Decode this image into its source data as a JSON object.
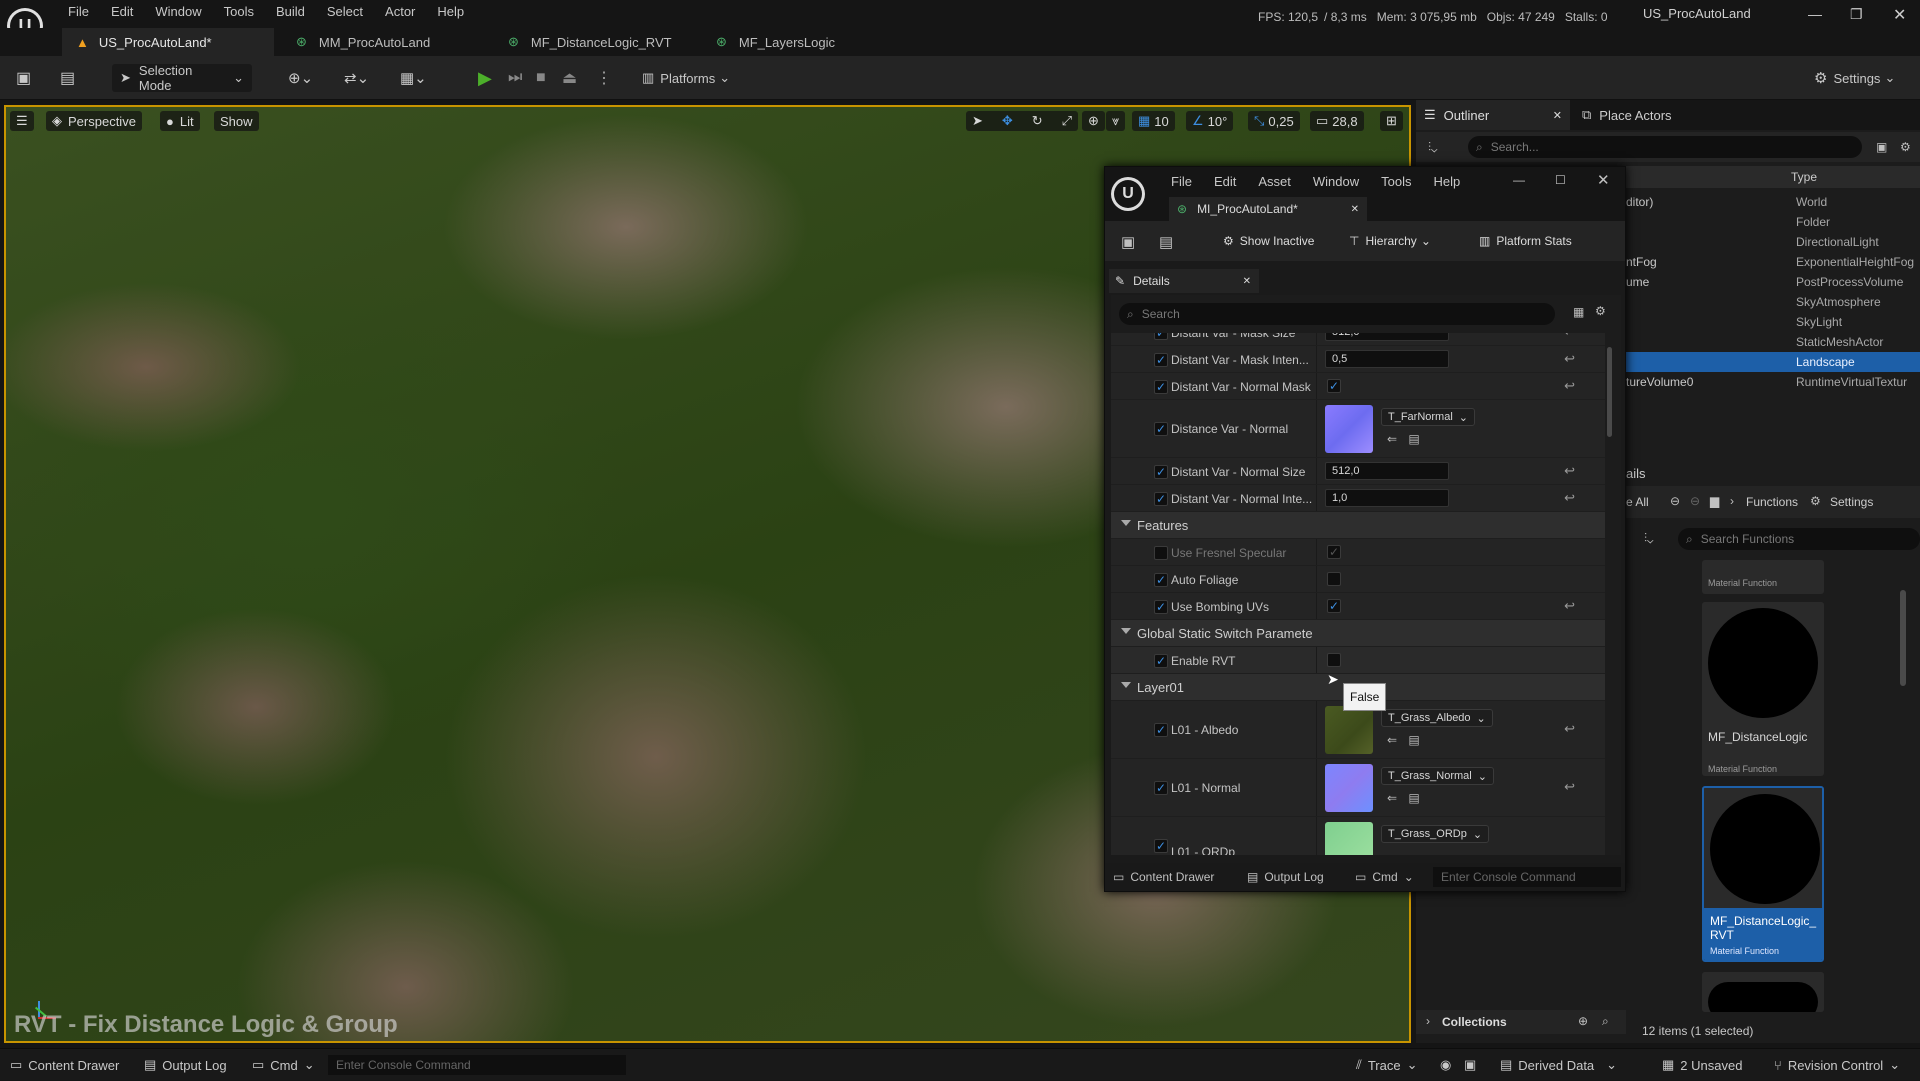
{
  "menu": [
    "File",
    "Edit",
    "Window",
    "Tools",
    "Build",
    "Select",
    "Actor",
    "Help"
  ],
  "stats": {
    "fps": "FPS: 120,5",
    "ms": "/ 8,3 ms",
    "mem": "Mem: 3 075,95 mb",
    "objs": "Objs: 47 249",
    "stalls": "Stalls: 0"
  },
  "project_name": "US_ProcAutoLand",
  "tabs": [
    {
      "label": "US_ProcAutoLand*",
      "active": true
    },
    {
      "label": "MM_ProcAutoLand",
      "active": false
    },
    {
      "label": "MF_DistanceLogic_RVT",
      "active": false
    },
    {
      "label": "MF_LayersLogic",
      "active": false
    }
  ],
  "toolbar": {
    "selection_mode": "Selection Mode",
    "platforms": "Platforms",
    "settings": "Settings"
  },
  "viewport": {
    "perspective": "Perspective",
    "lit": "Lit",
    "show": "Show",
    "grid_snap": "10",
    "angle_snap": "10°",
    "scale_snap": "0,25",
    "camera_speed": "28,8",
    "caption": "RVT - Fix Distance Logic & Group"
  },
  "outliner": {
    "tab_outliner": "Outliner",
    "tab_place_actors": "Place Actors",
    "search_placeholder": "Search...",
    "col_type": "Type",
    "rows": [
      {
        "name": "ditor)",
        "type": "World",
        "selected": false
      },
      {
        "name": "",
        "type": "Folder",
        "selected": false
      },
      {
        "name": "",
        "type": "DirectionalLight",
        "selected": false
      },
      {
        "name": "ntFog",
        "type": "ExponentialHeightFog",
        "selected": false
      },
      {
        "name": "ume",
        "type": "PostProcessVolume",
        "selected": false
      },
      {
        "name": "",
        "type": "SkyAtmosphere",
        "selected": false
      },
      {
        "name": "",
        "type": "SkyLight",
        "selected": false
      },
      {
        "name": "",
        "type": "StaticMeshActor",
        "selected": false
      },
      {
        "name": "",
        "type": "Landscape",
        "selected": true
      },
      {
        "name": "tureVolume0",
        "type": "RuntimeVirtualTextur",
        "selected": false
      }
    ],
    "details_label": "ails"
  },
  "content": {
    "all_label": "e All",
    "functions": "Functions",
    "settings": "Settings",
    "search_placeholder": "Search Functions",
    "tiles": [
      {
        "name": "",
        "sub": "Material Function",
        "selected": false
      },
      {
        "name": "MF_DistanceLogic",
        "sub": "Material Function",
        "selected": false
      },
      {
        "name": "MF_DistanceLogic_RVT",
        "sub": "Material Function",
        "selected": true
      }
    ],
    "collections": "Collections",
    "items_count": "12 items (1 selected)"
  },
  "material_window": {
    "menu": [
      "File",
      "Edit",
      "Asset",
      "Window",
      "Tools",
      "Help"
    ],
    "tab": "MI_ProcAutoLand*",
    "show_inactive": "Show Inactive",
    "hierarchy": "Hierarchy",
    "platform_stats": "Platform Stats",
    "details_tab": "Details",
    "search_placeholder": "Search",
    "partial_top": "Distant Var - Mask Size",
    "partial_top_value": "512,0",
    "rows": [
      {
        "name": "Distant Var - Mask Inten...",
        "value": "0,5"
      },
      {
        "name": "Distant Var - Normal Mask"
      },
      {
        "name": "Distance Var - Normal",
        "texture": "T_FarNormal"
      },
      {
        "name": "Distant Var - Normal Size",
        "value": "512,0"
      },
      {
        "name": "Distant Var - Normal Inte...",
        "value": "1,0"
      }
    ],
    "features_cat": "Features",
    "features": [
      {
        "name": "Use Fresnel Specular"
      },
      {
        "name": "Auto Foliage"
      },
      {
        "name": "Use Bombing UVs"
      }
    ],
    "switch_cat": "Global Static Switch Paramete",
    "enable_rvt": "Enable RVT",
    "tooltip": "False",
    "layer_cat": "Layer01",
    "layer_rows": [
      {
        "name": "L01 - Albedo",
        "texture": "T_Grass_Albedo"
      },
      {
        "name": "L01 - Normal",
        "texture": "T_Grass_Normal"
      },
      {
        "name": "L01 - ORDp",
        "texture": "T_Grass_ORDp"
      }
    ],
    "content_drawer": "Content Drawer",
    "output_log": "Output Log",
    "cmd": "Cmd",
    "console_placeholder": "Enter Console Command"
  },
  "statusbar": {
    "content_drawer": "Content Drawer",
    "output_log": "Output Log",
    "cmd": "Cmd",
    "console_placeholder": "Enter Console Command",
    "trace": "Trace",
    "derived_data": "Derived Data",
    "unsaved": "2 Unsaved",
    "revision_control": "Revision Control"
  },
  "colors": {
    "accent": "#3d8ee0",
    "selected_row": "#1d5fa8",
    "viewport_border": "#c89400",
    "play": "#4caf2a"
  }
}
